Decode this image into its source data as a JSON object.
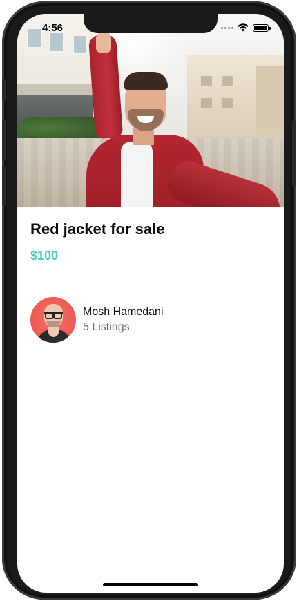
{
  "status_bar": {
    "time": "4:56"
  },
  "listing": {
    "image_icon": "person-photo",
    "title": "Red jacket for sale",
    "price": "$100"
  },
  "seller": {
    "avatar_icon": "avatar-photo",
    "name": "Mosh Hamedani",
    "listings": "5 Listings"
  },
  "colors": {
    "accent_price": "#4ecdc4",
    "title_text": "#0c0c0c",
    "secondary_text": "#6e6969"
  }
}
